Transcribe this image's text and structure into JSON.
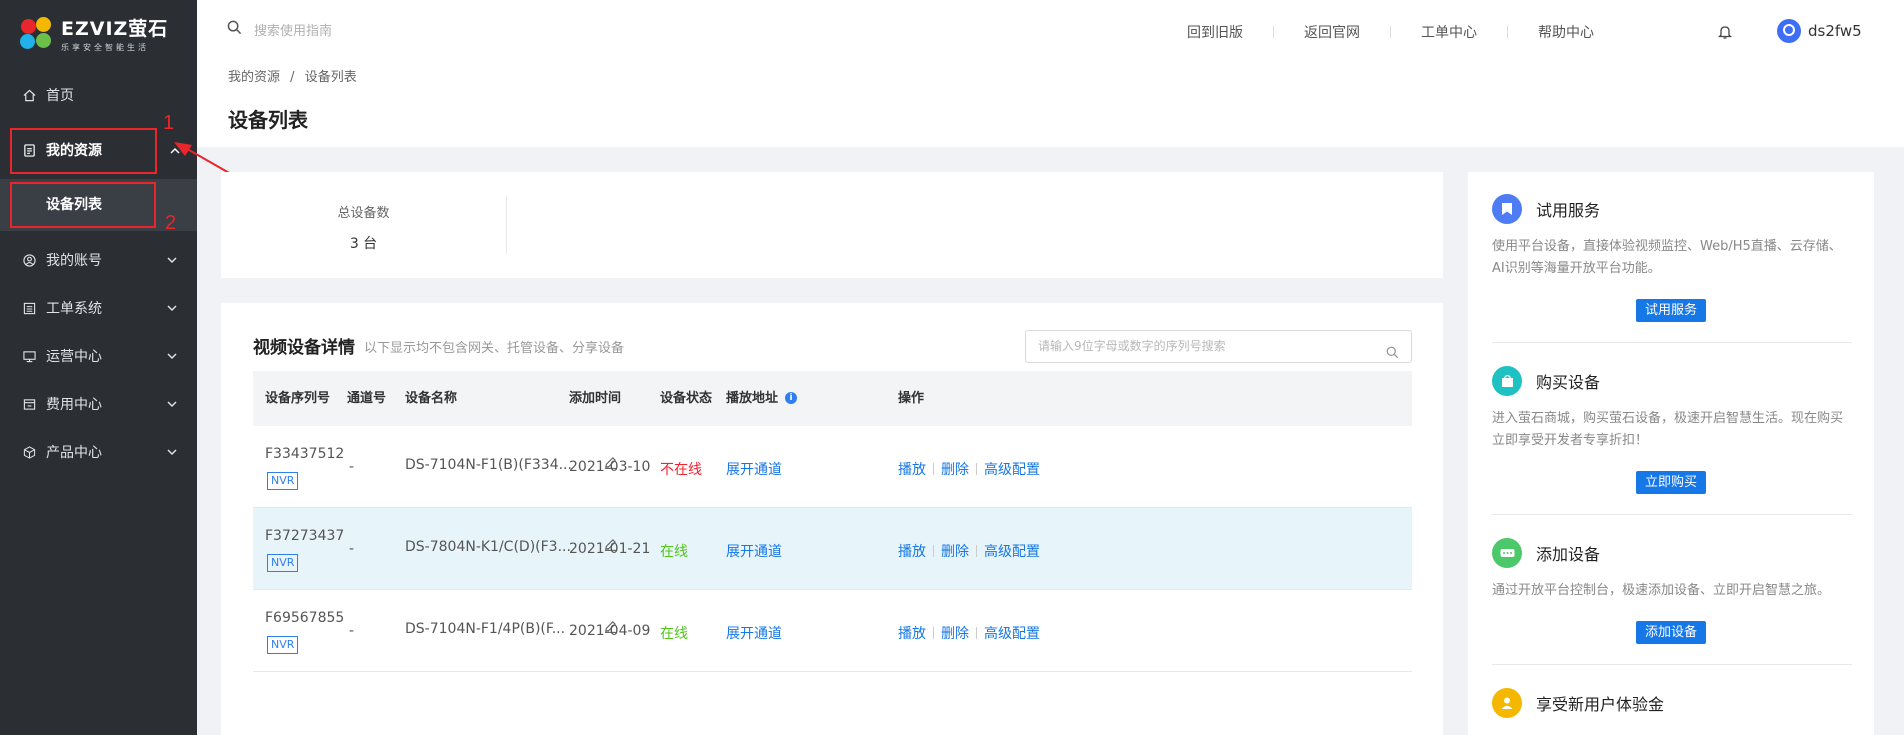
{
  "app": {
    "logo_name": "EZVIZ萤石",
    "logo_sub": "乐享安全智能生活",
    "brand_color": "#1677e6"
  },
  "sidebar": {
    "items": [
      {
        "label": "首页",
        "icon": "home-icon",
        "has_chevron": false
      },
      {
        "label": "我的资源",
        "icon": "document-icon",
        "has_chevron": true,
        "expanded": true
      },
      {
        "label": "我的账号",
        "icon": "user-circle-icon",
        "has_chevron": true
      },
      {
        "label": "工单系统",
        "icon": "list-icon",
        "has_chevron": true
      },
      {
        "label": "运营中心",
        "icon": "monitor-icon",
        "has_chevron": true
      },
      {
        "label": "费用中心",
        "icon": "billing-icon",
        "has_chevron": true
      },
      {
        "label": "产品中心",
        "icon": "box-icon",
        "has_chevron": true
      }
    ],
    "sub_item": {
      "label": "设备列表"
    },
    "annotations": {
      "num1": "1",
      "num2": "2",
      "color": "#e8262b"
    }
  },
  "header": {
    "search_placeholder": "搜索使用指南",
    "links": [
      "回到旧版",
      "返回官网",
      "工单中心",
      "帮助中心"
    ],
    "username": "ds2fw5"
  },
  "breadcrumb": {
    "root": "我的资源",
    "sep": "/",
    "current": "设备列表"
  },
  "page_title": "设备列表",
  "stats": {
    "label": "总设备数",
    "value": "3 台"
  },
  "table": {
    "title": "视频设备详情",
    "subtitle": "以下显示均不包含网关、托管设备、分享设备",
    "search_placeholder": "请输入9位字母或数字的序列号搜索",
    "columns": [
      "设备序列号",
      "通道号",
      "设备名称",
      "添加时间",
      "设备状态",
      "播放地址",
      "操作"
    ],
    "rows": [
      {
        "serial": "F33437512",
        "tag": "NVR",
        "channel": "-",
        "name": "DS-7104N-F1(B)(F334...",
        "added": "2021-03-10",
        "status": "不在线",
        "online": false,
        "address": "展开通道",
        "ops": [
          "播放",
          "删除",
          "高级配置"
        ]
      },
      {
        "serial": "F37273437",
        "tag": "NVR",
        "channel": "-",
        "name": "DS-7804N-K1/C(D)(F3...",
        "added": "2021-01-21",
        "status": "在线",
        "online": true,
        "address": "展开通道",
        "ops": [
          "播放",
          "删除",
          "高级配置"
        ]
      },
      {
        "serial": "F69567855",
        "tag": "NVR",
        "channel": "-",
        "name": "DS-7104N-F1/4P(B)(F...",
        "added": "2021-04-09",
        "status": "在线",
        "online": true,
        "address": "展开通道",
        "ops": [
          "播放",
          "删除",
          "高级配置"
        ]
      }
    ]
  },
  "services": [
    {
      "title": "试用服务",
      "desc": "使用平台设备，直接体验视频监控、Web/H5直播、云存储、AI识别等海量开放平台功能。",
      "button": "试用服务",
      "icon": "bookmark-icon",
      "color": "#4d7cf5"
    },
    {
      "title": "购买设备",
      "desc": "进入萤石商城，购买萤石设备，极速开启智慧生活。现在购买立即享受开发者专享折扣！",
      "button": "立即购买",
      "icon": "shopping-bag-icon",
      "color": "#1fc2c2"
    },
    {
      "title": "添加设备",
      "desc": "通过开放平台控制台，极速添加设备、立即开启智慧之旅。",
      "button": "添加设备",
      "icon": "device-add-icon",
      "color": "#4bc86a"
    },
    {
      "title": "享受新用户体验金",
      "icon": "user-gift-icon",
      "color": "#f5b800"
    }
  ]
}
